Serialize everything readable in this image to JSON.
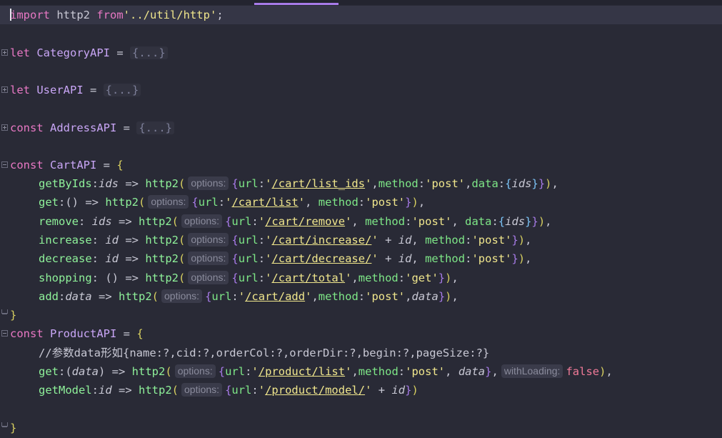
{
  "editor": {
    "language": "javascript",
    "lines": {
      "import": {
        "kw1": "import",
        "name": " http2 ",
        "kw2": "from",
        "path": "'../util/http'",
        "end": ";"
      },
      "category": {
        "kw": "let",
        "name": " CategoryAPI ",
        "eq": "= ",
        "folded": "{...}"
      },
      "user": {
        "kw": "let",
        "name": " UserAPI ",
        "eq": "= ",
        "folded": "{...}"
      },
      "address": {
        "kw": "const",
        "name": " AddressAPI ",
        "eq": "= ",
        "folded": "{...}"
      },
      "cart_open": {
        "kw": "const",
        "name": " CartAPI ",
        "eq": "= ",
        "brace": "{"
      },
      "cart_close": "}",
      "product_open": {
        "kw": "const",
        "name": " ProductAPI ",
        "eq": "= ",
        "brace": "{"
      },
      "product_close": "}",
      "comment": "//参数data形如{name:?,cid:?,orderCol:?,orderDir:?,begin:?,pageSize:?}"
    },
    "cart_methods": [
      {
        "name": "getByIds",
        "params": "ids",
        "url": "/cart/list_ids",
        "method": "post"
      },
      {
        "name": "get",
        "params": "()",
        "url": "/cart/list",
        "method": "post"
      },
      {
        "name": "remove",
        "params": "ids",
        "url": "/cart/remove",
        "method": "post"
      },
      {
        "name": "increase",
        "params": "id",
        "url": "/cart/increase/",
        "method": "post"
      },
      {
        "name": "decrease",
        "params": "id",
        "url": "/cart/decrease/",
        "method": "post"
      },
      {
        "name": "shopping",
        "params": "()",
        "url": "/cart/total",
        "method": "get"
      },
      {
        "name": "add",
        "params": "data",
        "url": "/cart/add",
        "method": "post"
      }
    ],
    "product_methods": [
      {
        "name": "get",
        "params": "data",
        "url": "/product/list",
        "method": "post",
        "withLoading": "false"
      },
      {
        "name": "getModel",
        "params": "id",
        "url": "/product/model/"
      }
    ],
    "hints": {
      "options": "options:",
      "withLoading": "withLoading:"
    }
  }
}
